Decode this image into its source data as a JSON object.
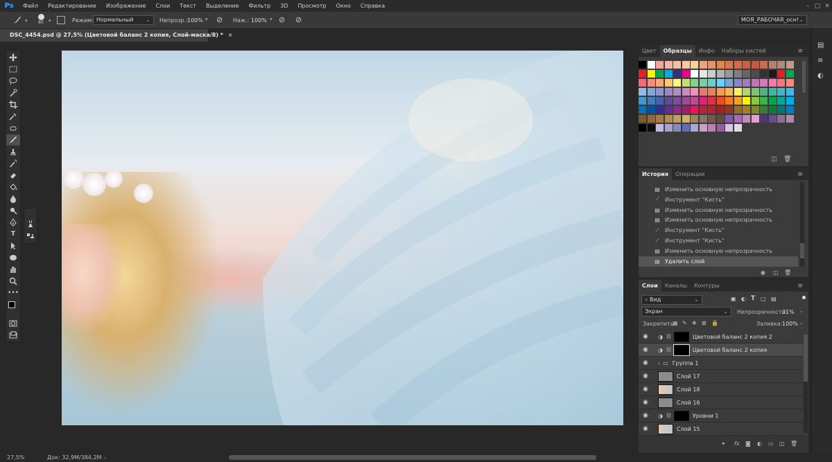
{
  "menubar": {
    "logo": "Ps",
    "items": [
      "Файл",
      "Редактирование",
      "Изображение",
      "Слои",
      "Текст",
      "Выделение",
      "Фильтр",
      "3D",
      "Просмотр",
      "Окно",
      "Справка"
    ],
    "window_controls": [
      "–",
      "□",
      "✕"
    ]
  },
  "options": {
    "brush_size": "80",
    "mode_label": "Режим:",
    "mode_value": "Нормальный",
    "opacity_label": "Непрозр.:",
    "opacity_value": "100%",
    "flow_label": "Наж.:",
    "flow_value": "100%",
    "workspace": "МОЯ_РАБОЧАЯ_осн!"
  },
  "document": {
    "tab_title": "DSC_4454.psd @ 27,5% (Цветовой баланс 2 копия, Слой-маска/8) *",
    "close": "×",
    "zoom": "27,5%",
    "doc_info": "Док: 32,9M/384,2M"
  },
  "swatches_panel": {
    "tabs": [
      "Цвет",
      "Образцы",
      "Инфо",
      "Наборы кистей"
    ],
    "active_tab": "Образцы",
    "colors": [
      [
        "#000000",
        "#ffffff",
        "#f3a5a1",
        "#f5b3a3",
        "#f7c0a4",
        "#f7c8a3",
        "#f8d0a2",
        "#efa27b",
        "#e79166",
        "#e0884f",
        "#d9774a",
        "#d7694b",
        "#cc5f44",
        "#c45a3f",
        "#c26d56",
        "#b98069",
        "#ad8a79",
        "#c09b8d"
      ],
      [
        "#ee1c24",
        "#fff200",
        "#00a650",
        "#00aeef",
        "#2e3192",
        "#ec008c",
        "#ffffff",
        "#e6e6e6",
        "#cccccc",
        "#b3b3b3",
        "#999999",
        "#808080",
        "#666666",
        "#4d4d4d",
        "#333333",
        "#1a1a1a",
        "#ed1c24",
        "#00a651"
      ],
      [
        "#f26c7a",
        "#f58b7d",
        "#f8a87c",
        "#fbc77a",
        "#fff57a",
        "#c3df7c",
        "#8dd08b",
        "#7bcda5",
        "#6fcfc6",
        "#6ed0f6",
        "#7fa5d6",
        "#8a87c3",
        "#a17ebb",
        "#b979b6",
        "#d27bb4",
        "#ef7ab2",
        "#f37787",
        "#f58b7c"
      ],
      [
        "#8fbbe8",
        "#7fa8dc",
        "#8b96cf",
        "#9a8bc5",
        "#b18cc5",
        "#c88cc3",
        "#ec91b8",
        "#f0766d",
        "#f47b54",
        "#f89b50",
        "#fbb74f",
        "#fff055",
        "#b8d464",
        "#80c46d",
        "#4db381",
        "#3bb9a8",
        "#3ebac6",
        "#3fb8ec"
      ],
      [
        "#3d9ad6",
        "#3f7ec1",
        "#4863ad",
        "#5b4a9f",
        "#7e4b9d",
        "#9a4c9b",
        "#c14b90",
        "#ed1c7b",
        "#ee2a3c",
        "#f04b23",
        "#f57d20",
        "#f9a11b",
        "#fff200",
        "#8dc63f",
        "#39b54a",
        "#00a651",
        "#00a99d",
        "#00aeef"
      ],
      [
        "#0072bc",
        "#0054a6",
        "#2e3192",
        "#662d91",
        "#92278f",
        "#9e1f63",
        "#ed145b",
        "#c22032",
        "#be1e2d",
        "#a3211f",
        "#8c3a21",
        "#9b6b26",
        "#a67c27",
        "#7d8a2d",
        "#3d7c37",
        "#0d7b3b",
        "#007a6e",
        "#007cc3"
      ],
      [
        "#7b5c2e",
        "#8c6a3c",
        "#a47b45",
        "#b08c52",
        "#c19c5c",
        "#cfae71",
        "#9c8366",
        "#8a7363",
        "#705a4f",
        "#5e4d3f",
        "#7f5ba7",
        "#a46bb5",
        "#c287c1",
        "#e1a3cc",
        "#4c3b71",
        "#6a4d8a",
        "#887090",
        "#a68eaf"
      ],
      [
        "#000000",
        "#0d0d0d",
        "#c6b8e0",
        "#a7a2d6",
        "#8688c4",
        "#5f6fb1",
        "#a7a7d0",
        "#c9a0c9",
        "#bf7bb4",
        "#9b5b9f",
        "#d8c7e3",
        "#e6d6ec"
      ]
    ]
  },
  "history_panel": {
    "tabs": [
      "История",
      "Операции"
    ],
    "active_tab": "История",
    "items": [
      {
        "icon": "doc",
        "label": "Изменить основную непрозрачность"
      },
      {
        "icon": "brush",
        "label": "Инструмент \"Кисть\""
      },
      {
        "icon": "doc",
        "label": "Изменить основную непрозрачность"
      },
      {
        "icon": "doc",
        "label": "Изменить основную непрозрачность"
      },
      {
        "icon": "brush",
        "label": "Инструмент \"Кисть\""
      },
      {
        "icon": "brush",
        "label": "Инструмент \"Кисть\""
      },
      {
        "icon": "doc",
        "label": "Изменить основную непрозрачность"
      },
      {
        "icon": "doc",
        "label": "Удалить слой"
      }
    ]
  },
  "layers_panel": {
    "tabs": [
      "Слои",
      "Каналы",
      "Контуры"
    ],
    "active_tab": "Слои",
    "filter_label": "Вид",
    "blend_mode": "Экран",
    "opacity_label": "Непрозрачность:",
    "opacity_value": "31%",
    "lock_label": "Закрепить:",
    "fill_label": "Заливка:",
    "fill_value": "100%",
    "layers": [
      {
        "name": "Цветовой баланс 2 копия 2",
        "type": "adjust",
        "selected": false
      },
      {
        "name": "Цветовой баланс 2 копия",
        "type": "adjust",
        "selected": true
      },
      {
        "name": "Группа 1",
        "type": "group",
        "selected": false
      },
      {
        "name": "Слой 17",
        "type": "gray",
        "selected": false
      },
      {
        "name": "Слой 18",
        "type": "photo",
        "selected": false
      },
      {
        "name": "Слой 16",
        "type": "gray",
        "selected": false
      },
      {
        "name": "Уровни 1",
        "type": "adjust",
        "selected": false
      },
      {
        "name": "Слой 15",
        "type": "photo",
        "selected": false
      }
    ]
  }
}
